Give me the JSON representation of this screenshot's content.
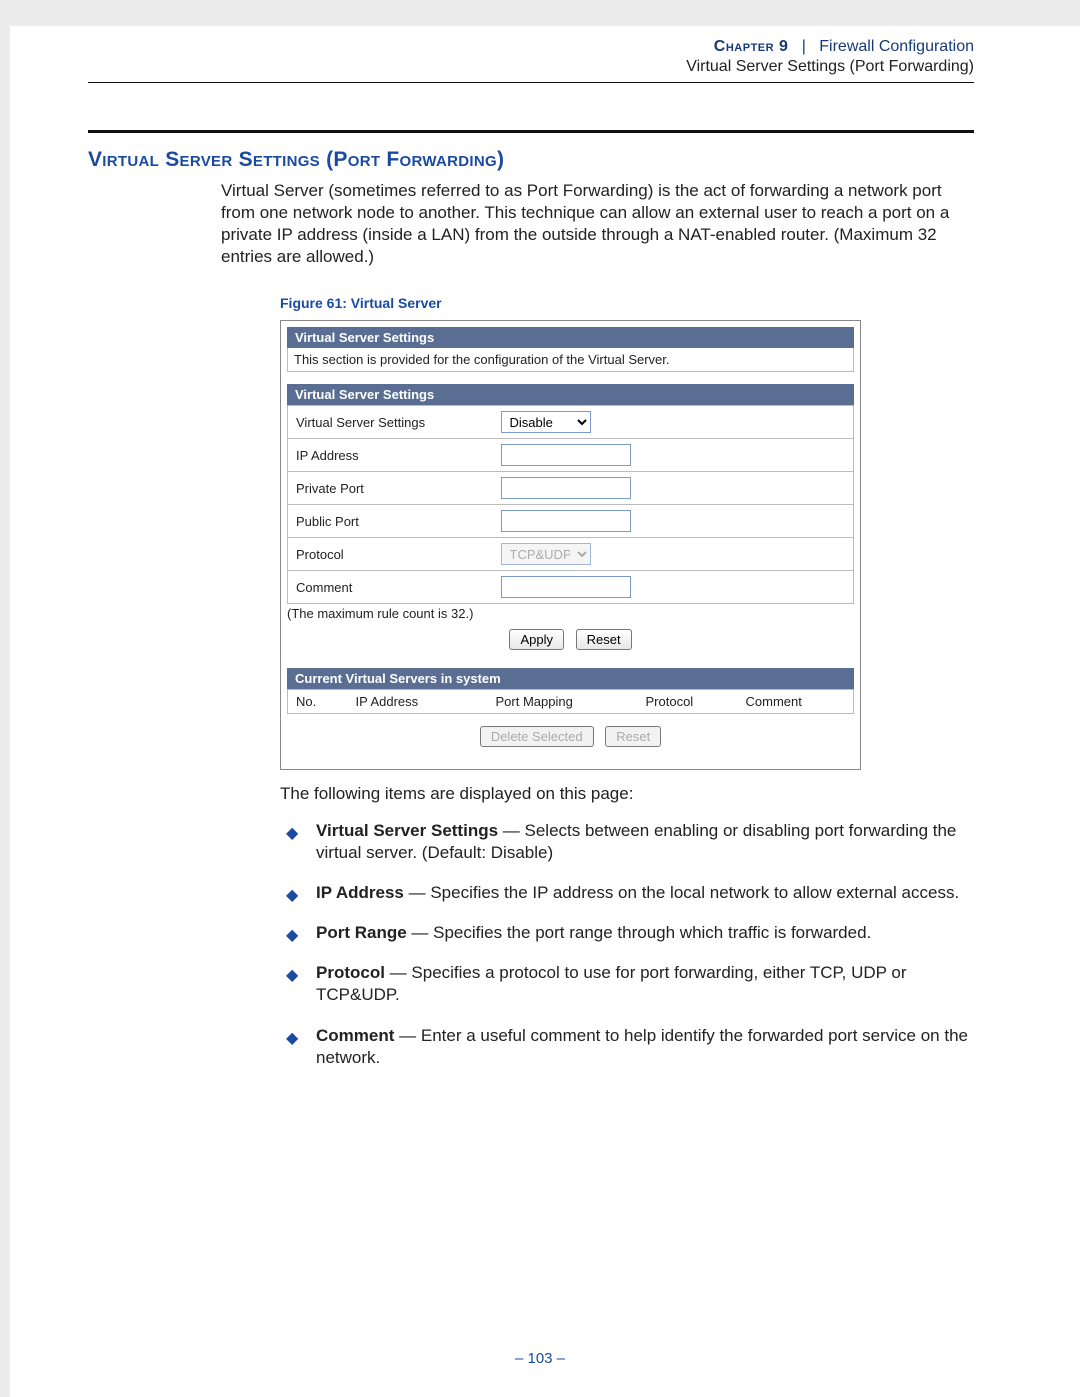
{
  "header": {
    "chapter_label": "Chapter 9",
    "separator": "|",
    "chapter_title": "Firewall Configuration",
    "subtitle": "Virtual Server Settings (Port Forwarding)"
  },
  "section": {
    "title": "Virtual Server Settings (Port Forwarding)",
    "intro": "Virtual Server (sometimes referred to as Port Forwarding) is the act of forwarding a network port from one network node to another. This technique can allow an external user to reach a port on a private IP address (inside a LAN) from the outside through a NAT-enabled router. (Maximum 32 entries are allowed.)"
  },
  "figure": {
    "caption": "Figure 61:  Virtual Server",
    "panel1_title": "Virtual Server Settings",
    "panel1_desc": "This section is provided for the configuration of the Virtual Server.",
    "panel2_title": "Virtual Server Settings",
    "fields": {
      "vss_label": "Virtual Server Settings",
      "vss_value": "Disable",
      "ip_label": "IP Address",
      "ip_value": "",
      "privport_label": "Private Port",
      "privport_value": "",
      "pubport_label": "Public Port",
      "pubport_value": "",
      "protocol_label": "Protocol",
      "protocol_value": "TCP&UDP",
      "comment_label": "Comment",
      "comment_value": ""
    },
    "max_note": "(The maximum rule count is 32.)",
    "buttons": {
      "apply": "Apply",
      "reset": "Reset"
    },
    "panel3_title": "Current Virtual Servers in system",
    "columns": {
      "no": "No.",
      "ip": "IP Address",
      "portmap": "Port Mapping",
      "protocol": "Protocol",
      "comment": "Comment"
    },
    "buttons2": {
      "delete": "Delete Selected",
      "reset": "Reset"
    }
  },
  "following": "The following items are displayed on this page:",
  "bullets": [
    {
      "term": "Virtual Server Settings",
      "desc": " — Selects between enabling or disabling port forwarding the virtual server. (Default: Disable)"
    },
    {
      "term": "IP Address",
      "desc": " — Specifies the IP address on the local network to allow external access."
    },
    {
      "term": "Port Range",
      "desc": " — Specifies the port range through which traffic is forwarded."
    },
    {
      "term": "Protocol",
      "desc": " — Specifies a protocol to use for port forwarding, either TCP, UDP or TCP&UDP."
    },
    {
      "term": "Comment",
      "desc": " — Enter a useful comment to help identify the forwarded port service on the network."
    }
  ],
  "page_number": "– 103 –"
}
